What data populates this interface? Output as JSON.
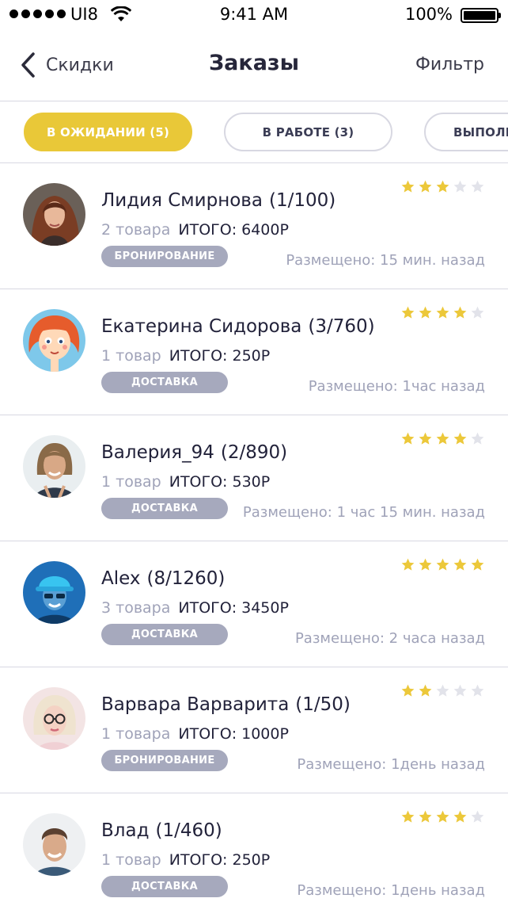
{
  "status_bar": {
    "carrier": "UI8",
    "time": "9:41 AM",
    "battery": "100%"
  },
  "nav": {
    "back_label": "Скидки",
    "title": "Заказы",
    "filter_label": "Фильтр"
  },
  "tabs": [
    {
      "label": "В ОЖИДАНИИ (5)",
      "active": true
    },
    {
      "label": "В РАБОТЕ (3)",
      "active": false
    },
    {
      "label": "ВЫПОЛНЕНО",
      "active": false
    }
  ],
  "colors": {
    "accent": "#e9c838",
    "star_on": "#ecc83a",
    "star_off": "#e2e3ea",
    "muted": "#9fa2b8",
    "badge": "#a6a9bd"
  },
  "orders": [
    {
      "name": "Лидия Смирнова",
      "count": "(1/100)",
      "items": "2 товара",
      "total": "ИТОГО: 6400Р",
      "badge": "БРОНИРОВАНИЕ",
      "placed": "Размещено: 15 мин. назад",
      "rating": 3,
      "avatar": "woman-dark-hair-avatar"
    },
    {
      "name": "Екатерина Сидорова",
      "count": "(3/760)",
      "items": "1 товар",
      "total": "ИТОГО: 250Р",
      "badge": "ДОСТАВКА",
      "placed": "Размещено: 1час назад",
      "rating": 4,
      "avatar": "cartoon-redhead-avatar"
    },
    {
      "name": "Валерия_94",
      "count": "(2/890)",
      "items": "1 товар",
      "total": "ИТОГО: 530Р",
      "badge": "ДОСТАВКА",
      "placed": "Размещено: 1 час 15 мин. назад",
      "rating": 4,
      "avatar": "woman-smiling-avatar"
    },
    {
      "name": "Alex",
      "count": "(8/1260)",
      "items": "3 товара",
      "total": "ИТОГО: 3450Р",
      "badge": "ДОСТАВКА",
      "placed": "Размещено: 2 часа назад",
      "rating": 5,
      "avatar": "man-blue-cap-avatar"
    },
    {
      "name": "Варвара Варварита",
      "count": "(1/50)",
      "items": "1 товара",
      "total": "ИТОГО: 1000Р",
      "badge": "БРОНИРОВАНИЕ",
      "placed": "Размещено: 1день назад",
      "rating": 2,
      "avatar": "blonde-glasses-avatar"
    },
    {
      "name": "Влад",
      "count": "(1/460)",
      "items": "1 товар",
      "total": "ИТОГО: 250Р",
      "badge": "ДОСТАВКА",
      "placed": "Размещено: 1день назад",
      "rating": 4,
      "avatar": "man-smiling-avatar"
    }
  ]
}
